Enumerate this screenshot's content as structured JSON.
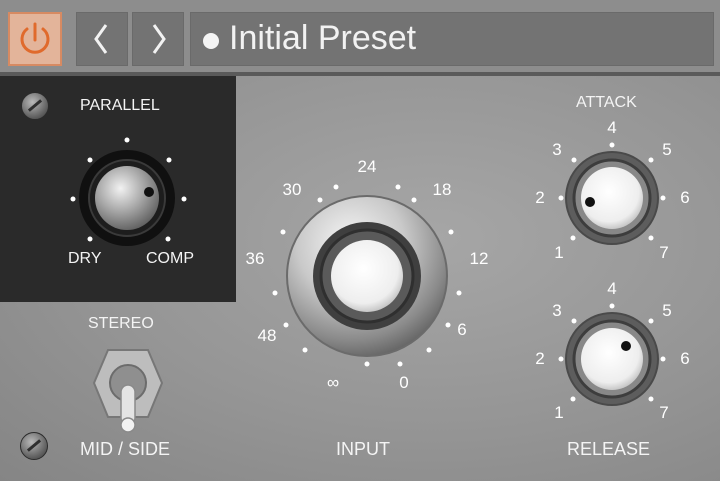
{
  "header": {
    "power_icon": "power-icon",
    "prev_icon": "chevron-left-icon",
    "next_icon": "chevron-right-icon",
    "preset_name": "Initial Preset",
    "accent_color": "#d78a62"
  },
  "parallel": {
    "title": "PARALLEL",
    "left_label": "DRY",
    "right_label": "COMP"
  },
  "stereo": {
    "title": "STEREO",
    "mode_label": "MID / SIDE"
  },
  "input": {
    "title": "INPUT",
    "scale": [
      "∞",
      "48",
      "36",
      "30",
      "24",
      "18",
      "12",
      "6",
      "0"
    ]
  },
  "attack": {
    "title": "ATTACK",
    "scale": [
      "1",
      "2",
      "3",
      "4",
      "5",
      "6",
      "7"
    ]
  },
  "release": {
    "title": "RELEASE",
    "scale": [
      "1",
      "2",
      "3",
      "4",
      "5",
      "6",
      "7"
    ]
  }
}
